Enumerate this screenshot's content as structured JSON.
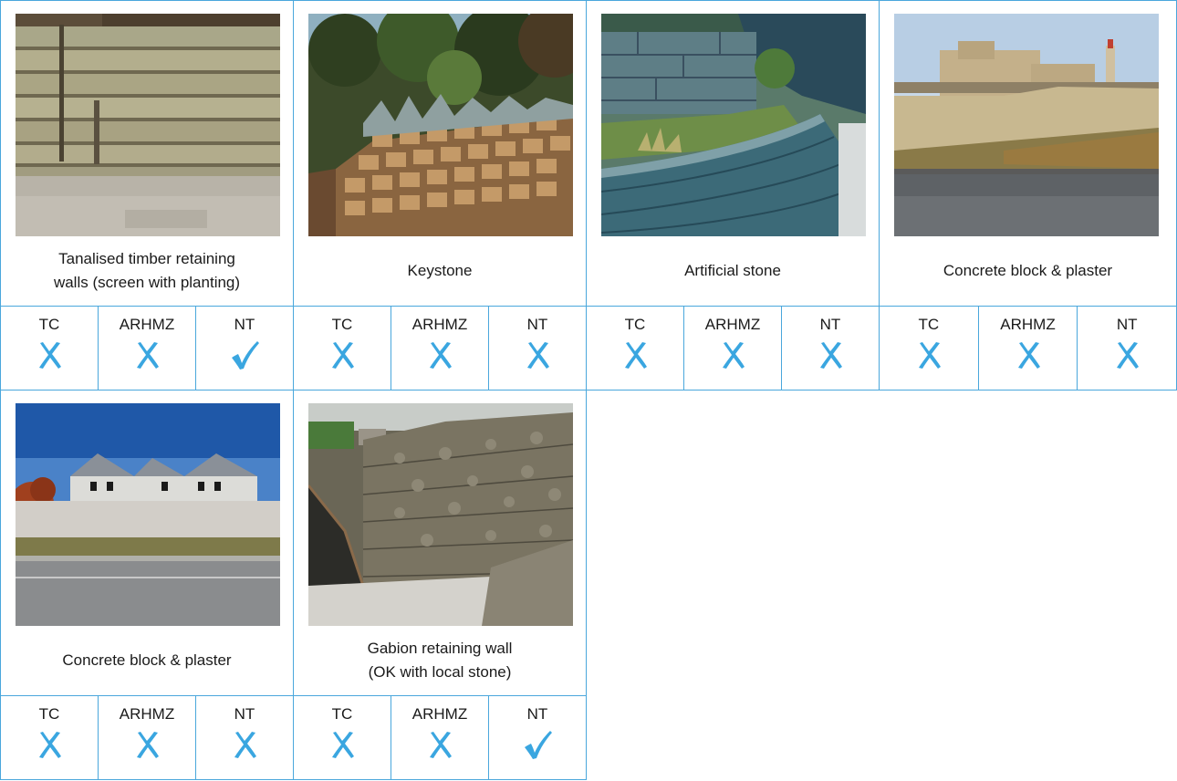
{
  "accent": "#3aa6e0",
  "cards": [
    {
      "caption": "Tanalised timber retaining\nwalls (screen with planting)",
      "photo": "timber-wall-photo",
      "ratings": [
        {
          "label": "TC",
          "mark": "cross"
        },
        {
          "label": "ARHMZ",
          "mark": "cross"
        },
        {
          "label": "NT",
          "mark": "tick"
        }
      ]
    },
    {
      "caption": "Keystone",
      "photo": "keystone-wall-photo",
      "ratings": [
        {
          "label": "TC",
          "mark": "cross"
        },
        {
          "label": "ARHMZ",
          "mark": "cross"
        },
        {
          "label": "NT",
          "mark": "cross"
        }
      ]
    },
    {
      "caption": "Artificial stone",
      "photo": "artificial-stone-photo",
      "ratings": [
        {
          "label": "TC",
          "mark": "cross"
        },
        {
          "label": "ARHMZ",
          "mark": "cross"
        },
        {
          "label": "NT",
          "mark": "cross"
        }
      ]
    },
    {
      "caption": "Concrete block & plaster",
      "photo": "concrete-block-photo",
      "ratings": [
        {
          "label": "TC",
          "mark": "cross"
        },
        {
          "label": "ARHMZ",
          "mark": "cross"
        },
        {
          "label": "NT",
          "mark": "cross"
        }
      ]
    },
    {
      "caption": "Concrete block & plaster",
      "photo": "concrete-block-house-photo",
      "ratings": [
        {
          "label": "TC",
          "mark": "cross"
        },
        {
          "label": "ARHMZ",
          "mark": "cross"
        },
        {
          "label": "NT",
          "mark": "cross"
        }
      ]
    },
    {
      "caption": "Gabion retaining wall\n(OK with local stone)",
      "photo": "gabion-wall-photo",
      "ratings": [
        {
          "label": "TC",
          "mark": "cross"
        },
        {
          "label": "ARHMZ",
          "mark": "cross"
        },
        {
          "label": "NT",
          "mark": "tick"
        }
      ]
    }
  ]
}
